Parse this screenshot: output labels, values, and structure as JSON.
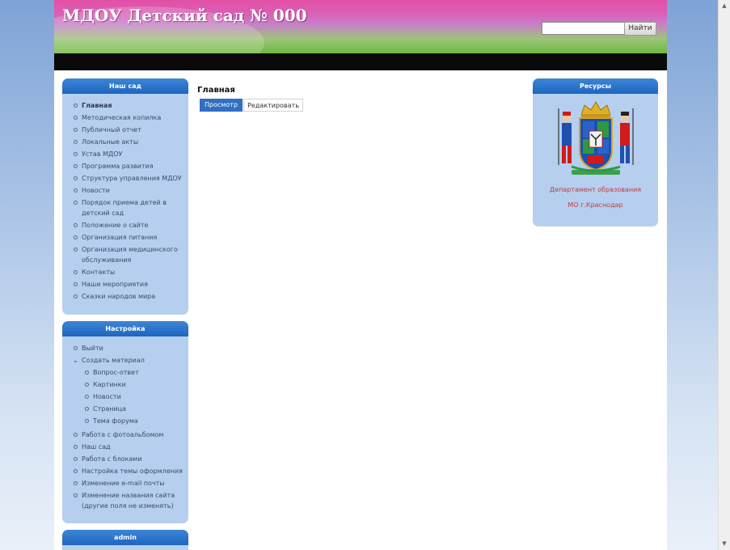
{
  "header": {
    "site_title": "МДОУ Детский сад № 000",
    "search_placeholder": "",
    "search_button": "Найти"
  },
  "sidebar_nav": {
    "title": "Наш сад",
    "items": [
      {
        "label": "Главная",
        "active": true
      },
      {
        "label": "Методическая копилка"
      },
      {
        "label": "Публичный отчет"
      },
      {
        "label": "Локальные акты"
      },
      {
        "label": "Устав МДОУ"
      },
      {
        "label": "Программа развития"
      },
      {
        "label": "Структура управления МДОУ"
      },
      {
        "label": "Новости"
      },
      {
        "label": "Порядок приема детей в детский сад"
      },
      {
        "label": "Положение о сайте"
      },
      {
        "label": "Организация питания"
      },
      {
        "label": "Организация медицинского обслуживания"
      },
      {
        "label": "Контакты"
      },
      {
        "label": "Наши мероприятия"
      },
      {
        "label": "Сказки народов мира"
      }
    ]
  },
  "sidebar_settings": {
    "title": "Настройка",
    "items": [
      {
        "label": "Выйти"
      },
      {
        "label": "Создать материал",
        "expanded": true,
        "children": [
          "Вопрос-ответ",
          "Картинки",
          "Новости",
          "Страница",
          "Тема форума"
        ]
      },
      {
        "label": "Работа с фотоальбомом"
      },
      {
        "label": "Наш сад"
      },
      {
        "label": "Работа с блоками"
      },
      {
        "label": "Настройка темы оформления"
      },
      {
        "label": "Изменение e-mail почты"
      },
      {
        "label": "Изменение названия сайта (другие поля не изменять)"
      }
    ]
  },
  "sidebar_admin": {
    "title": "admin"
  },
  "main": {
    "title": "Главная",
    "tabs": [
      {
        "label": "Просмотр",
        "active": true
      },
      {
        "label": "Редактировать"
      }
    ]
  },
  "resources": {
    "title": "Ресурсы",
    "emblem_icon": "krasnodar-coat-of-arms-icon",
    "link_line1": "Департамент образования",
    "link_line2": "МО г.Краснодар"
  },
  "colors": {
    "block_bg": "#b6cfee",
    "block_header": "#1e65bf",
    "header_pink": "#e24fa4",
    "header_green": "#6db83d",
    "link_red": "#c23b3b"
  }
}
